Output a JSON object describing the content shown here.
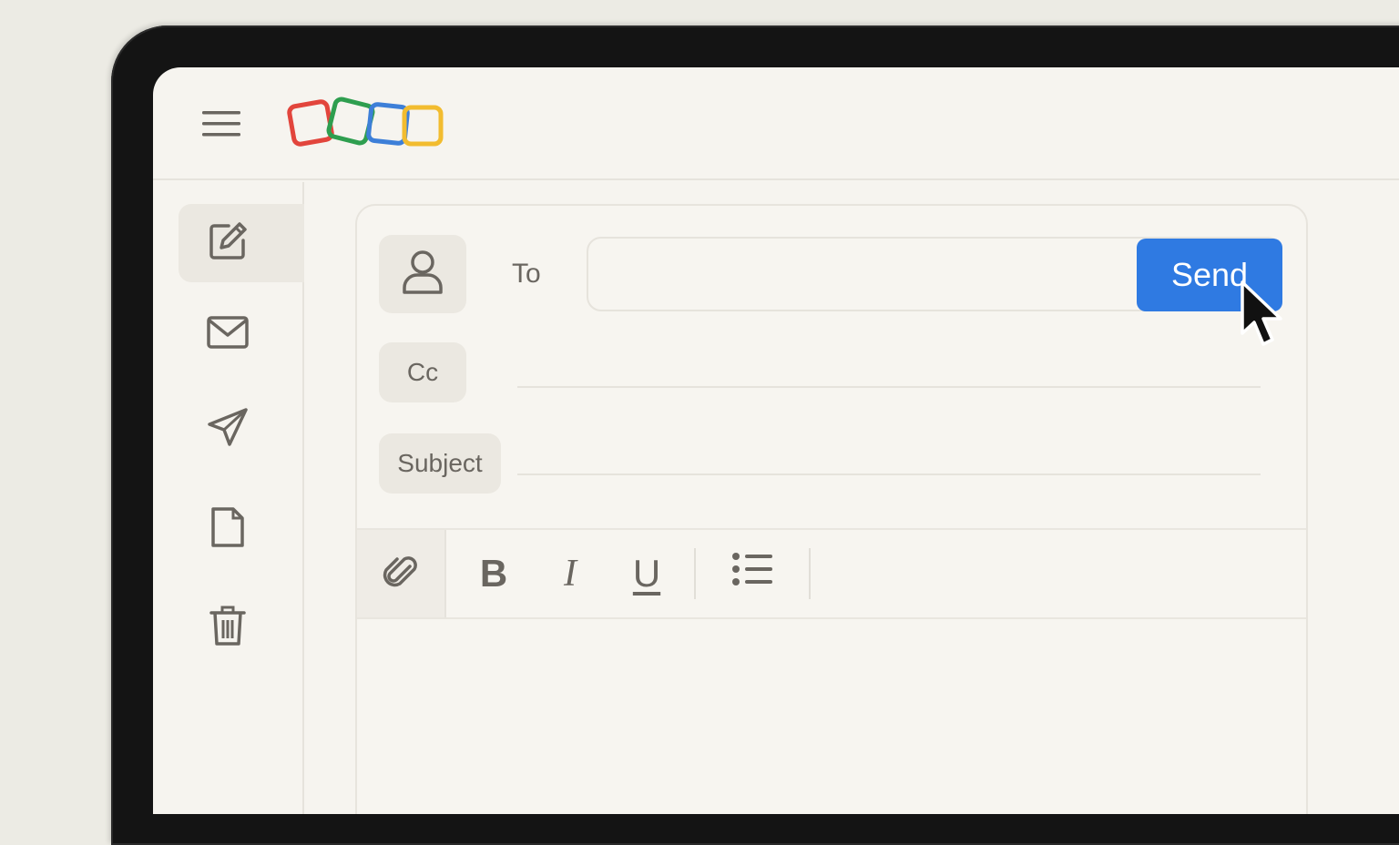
{
  "compose": {
    "to_label": "To",
    "to_value": "",
    "send_label": "Send",
    "cc_label": "Cc",
    "cc_value": "",
    "subject_label": "Subject",
    "subject_value": "",
    "body_value": ""
  },
  "toolbar": {
    "bold": "B",
    "italic": "I",
    "underline": "U"
  },
  "sidebar": {
    "items": [
      {
        "icon": "compose-icon",
        "active": true
      },
      {
        "icon": "mail-icon",
        "active": false
      },
      {
        "icon": "send-icon",
        "active": false
      },
      {
        "icon": "document-icon",
        "active": false
      },
      {
        "icon": "trash-icon",
        "active": false
      }
    ]
  },
  "colors": {
    "accent": "#2f7ae2",
    "logo_red": "#e2453c",
    "logo_green": "#2e9e4f",
    "logo_blue": "#3d7fd8",
    "logo_yellow": "#f2bc2f"
  }
}
